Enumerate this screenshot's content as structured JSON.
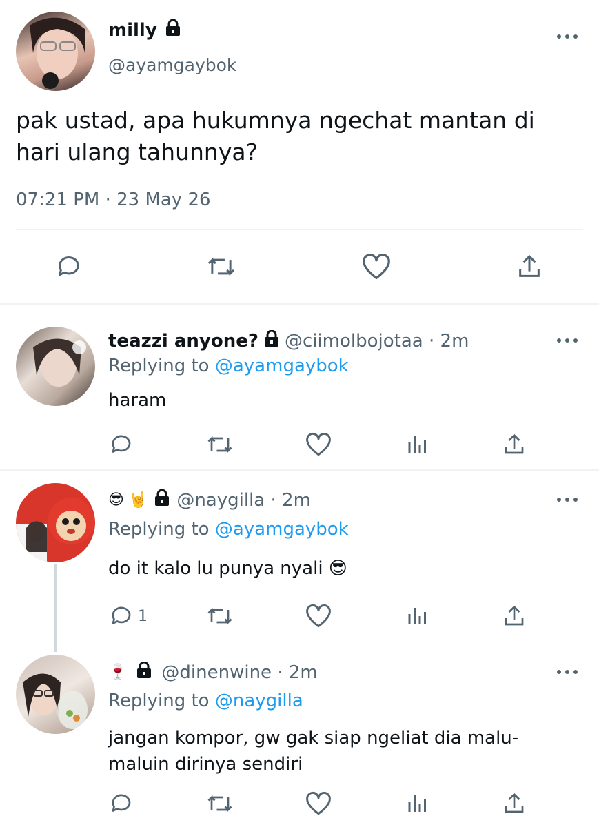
{
  "main_tweet": {
    "display_name": "milly",
    "handle": "@ayamgaybok",
    "text_line1": "pak ustad, apa hukumnya ngechat mantan di",
    "text_line2": "hari ulang tahunnya?",
    "timestamp": "07:21 PM · 23 May 26",
    "icons": [
      "reply-icon",
      "retweet-icon",
      "like-icon",
      "share-icon"
    ]
  },
  "replies": [
    {
      "display_name": "teazzi anyone?",
      "handle_time": "@ciimolbojotaa · 2m",
      "replying_prefix": "Replying to",
      "replying_to": "@ayamgaybok",
      "text": "haram",
      "reply_count": ""
    },
    {
      "display_emoji": "😎 🤘",
      "handle_time": "@naygilla · 2m",
      "replying_prefix": "Replying to",
      "replying_to": "@ayamgaybok",
      "text": "do it kalo lu punya nyali 😎",
      "reply_count": "1"
    },
    {
      "display_emoji": "🍷",
      "handle_time": "@dinenwine · 2m",
      "replying_prefix": "Replying to",
      "replying_to": "@naygilla",
      "text_line1": "jangan kompor, gw gak siap ngeliat dia malu-",
      "text_line2": "maluin dirinya sendiri",
      "reply_count": ""
    }
  ],
  "colors": {
    "text": "#0f1419",
    "muted": "#536471",
    "link": "#1d9bf0",
    "divider": "#eff3f4"
  }
}
